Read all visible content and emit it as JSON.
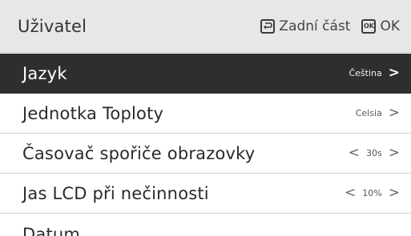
{
  "header": {
    "title": "Uživatel",
    "back_label": "Zadní část",
    "ok_key_text": "OK",
    "ok_label": "OK"
  },
  "menu": {
    "items": [
      {
        "label": "Jazyk",
        "value": "Čeština",
        "left_chevron": "",
        "right_chevron": ">"
      },
      {
        "label": "Jednotka Toploty",
        "value": "Celsia",
        "left_chevron": "",
        "right_chevron": ">"
      },
      {
        "label": "Časovač spořiče obrazovky",
        "value": "30s",
        "left_chevron": "<",
        "right_chevron": ">"
      },
      {
        "label": "Jas LCD při nečinnosti",
        "value": "10%",
        "left_chevron": "<",
        "right_chevron": ">"
      },
      {
        "label": "Datum",
        "value": "",
        "left_chevron": "",
        "right_chevron": ""
      }
    ],
    "selected_index": 0
  },
  "colors": {
    "header_bg": "#e7e7e7",
    "selected_row_bg": "#2e2e2e",
    "divider": "#cfcfcf"
  },
  "icons": {
    "back": "back-arrow-icon",
    "ok": "ok-key-icon",
    "chevron_right": "chevron-right-icon",
    "chevron_left": "chevron-left-icon"
  }
}
